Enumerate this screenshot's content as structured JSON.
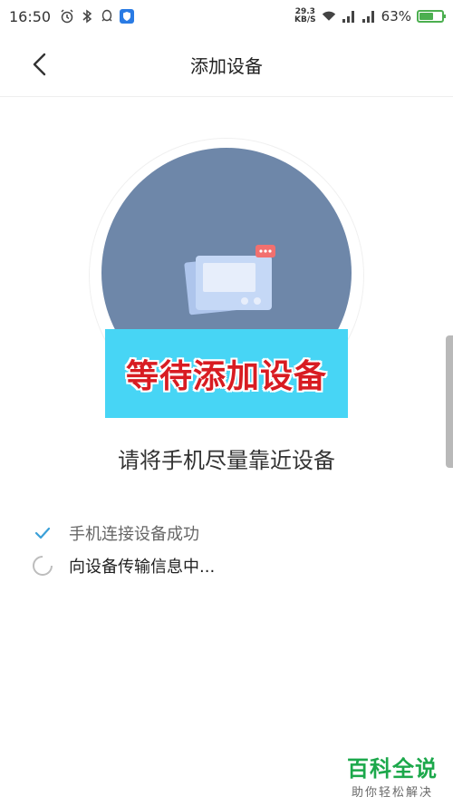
{
  "status_bar": {
    "time": "16:50",
    "net_speed_value": "29.3",
    "net_speed_unit": "KB/S",
    "battery_percent": "63%",
    "battery_level": 0.63
  },
  "nav": {
    "title": "添加设备"
  },
  "hero": {
    "banner_text": "等待添加设备"
  },
  "hint": "请将手机尽量靠近设备",
  "steps": [
    {
      "label": "手机连接设备成功",
      "state": "done"
    },
    {
      "label": "向设备传输信息中...",
      "state": "active"
    }
  ],
  "watermark": {
    "title": "百科全说",
    "subtitle": "助你轻松解决"
  },
  "colors": {
    "circle": "#6e87a9",
    "banner_bg": "#47d5f5",
    "banner_text": "#d81c22",
    "check": "#3aa0d8",
    "watermark": "#1ca84b",
    "battery": "#4caf50"
  }
}
